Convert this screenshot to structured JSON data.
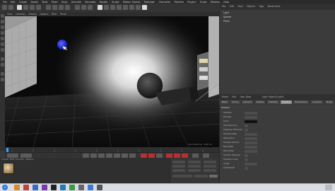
{
  "menu": {
    "items": [
      "File",
      "Edit",
      "Create",
      "Select",
      "Tools",
      "Mesh",
      "Snap",
      "Animate",
      "Simulate",
      "Render",
      "Sculpt",
      "Motion Tracker",
      "MoGraph",
      "Character",
      "Pipeline",
      "Plugins",
      "Script",
      "Window",
      "Help"
    ]
  },
  "viewport": {
    "menu": [
      "View",
      "Cameras",
      "Display",
      "Options",
      "Filter",
      "Panel"
    ],
    "status": "Grid Spacing : 100 cm"
  },
  "objects": {
    "tabs": [
      "File",
      "Edit",
      "View",
      "Objects",
      "Tags",
      "Bookmarks"
    ],
    "rows": [
      "Light",
      "Sphere",
      "Plane"
    ]
  },
  "attributes": {
    "header": [
      "Mode",
      "Edit",
      "User Data"
    ],
    "title": "Light Object [Light]",
    "tabs": [
      "Basic",
      "Coord.",
      "General",
      "Details",
      "Visibility",
      "Shadow",
      "Photometric",
      "Caustics",
      "Noise",
      "Lens",
      "Project"
    ],
    "active_tab": "Shadow",
    "section": "Shadow",
    "rows": [
      "Shadow",
      "Density",
      "Color",
      "Transparency",
      "Clipping Influence",
      "Shadow Map",
      "Resolution",
      "Sample Radius",
      "Bias (Rel)",
      "Bias (Abs)",
      "Outline Shadow",
      "Shadow Cone",
      "Angle",
      "Soft Falloff"
    ]
  },
  "materials": {
    "menu": [
      "Create",
      "Edit",
      "Function",
      "Texture"
    ]
  },
  "colors": {
    "record": "#b73131",
    "taskbar": "#d9dde3"
  }
}
